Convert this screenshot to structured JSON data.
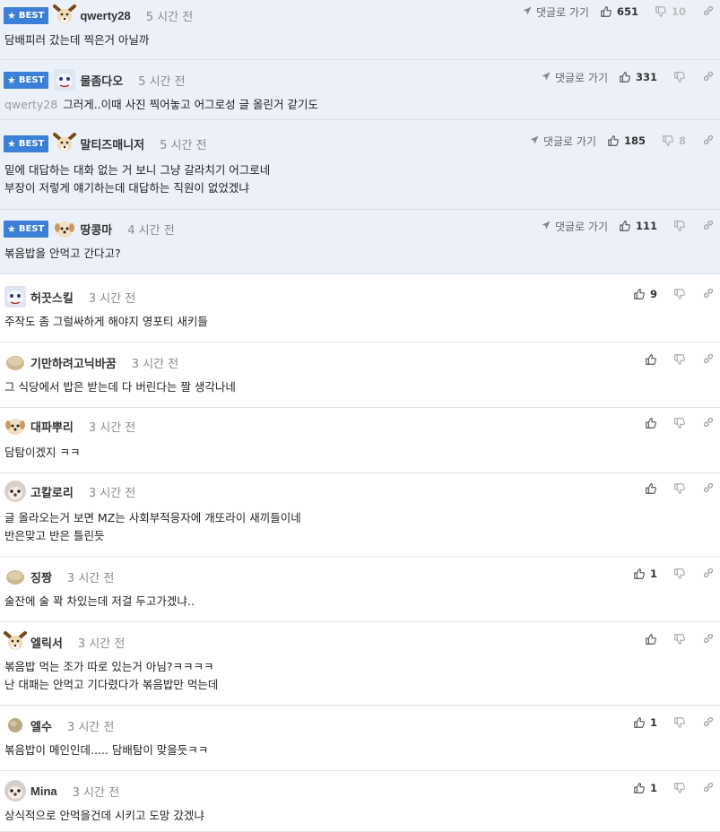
{
  "best_label": "BEST",
  "goto_label": "댓글로 가기",
  "comments": [
    {
      "nick": "qwerty28",
      "time": "5 시간 전",
      "lines": [
        "담배피러 갔는데 찍은거 아닐까"
      ],
      "up": "651",
      "down": "10",
      "best": true
    },
    {
      "nick": "물좀다오",
      "time": "5 시간 전",
      "reply_to": "qwerty28",
      "lines": [
        "그러게..이때 사진 찍어놓고 어그로성 글 올린거 같기도"
      ],
      "up": "331",
      "down": "",
      "best": true
    },
    {
      "nick": "말티즈매니저",
      "time": "5 시간 전",
      "lines": [
        "밑에 대답하는 대화 없는 거 보니 그냥 갈라치기 어그로네",
        "부장이 저렇게 얘기하는데 대답하는 직원이 없었겠냐"
      ],
      "up": "185",
      "down": "8",
      "best": true
    },
    {
      "nick": "땅콩마",
      "time": "4 시간 전",
      "lines": [
        "볶음밥을 안먹고 간다고?"
      ],
      "up": "111",
      "down": "",
      "best": true
    },
    {
      "nick": "허끗스킬",
      "time": "3 시간 전",
      "lines": [
        "주작도 좀 그럴싸하게 해야지 영포티 새키들"
      ],
      "up": "9",
      "down": ""
    },
    {
      "nick": "기만하려고닉바꿈",
      "time": "3 시간 전",
      "lines": [
        "그 식당에서 밥은 받는데 다 버린다는 짤 생각나네"
      ],
      "up": "",
      "down": ""
    },
    {
      "nick": "대파뿌리",
      "time": "3 시간 전",
      "lines": [
        "담탐이겠지 ㅋㅋ"
      ],
      "up": "",
      "down": ""
    },
    {
      "nick": "고칼로리",
      "time": "3 시간 전",
      "lines": [
        "글 올라오는거 보면 MZ는 사회부적응자에 개또라이 새끼들이네",
        "반은맞고 반은 틀린듯"
      ],
      "up": "",
      "down": ""
    },
    {
      "nick": "징짱",
      "time": "3 시간 전",
      "lines": [
        "술잔에 술 꽉 차있는데 저걸 두고가겠냐.."
      ],
      "up": "1",
      "down": ""
    },
    {
      "nick": "엘릭서",
      "time": "3 시간 전",
      "lines": [
        "볶음밥 먹는 조가 따로 있는거 아님?ㅋㅋㅋㅋ",
        "난 대패는 안먹고 기다렸다가 볶음밥만 먹는데"
      ],
      "up": "",
      "down": ""
    },
    {
      "nick": "엘수",
      "time": "3 시간 전",
      "lines": [
        "볶음밥이 메인인데..... 담배탐이 맞을듯ㅋㅋ"
      ],
      "up": "1",
      "down": ""
    },
    {
      "nick": "Mina",
      "time": "3 시간 전",
      "lines": [
        "상식적으로 안먹을건데 시키고 도망 갔겠냐"
      ],
      "up": "1",
      "down": ""
    }
  ],
  "icons": {
    "best": "star-icon",
    "goto": "send-arrow-icon",
    "up": "thumbs-up-icon",
    "down": "thumbs-down-icon",
    "link": "link-icon"
  },
  "colors": {
    "best_bg": "#ecf1f9",
    "badge": "#3c7fd9"
  }
}
